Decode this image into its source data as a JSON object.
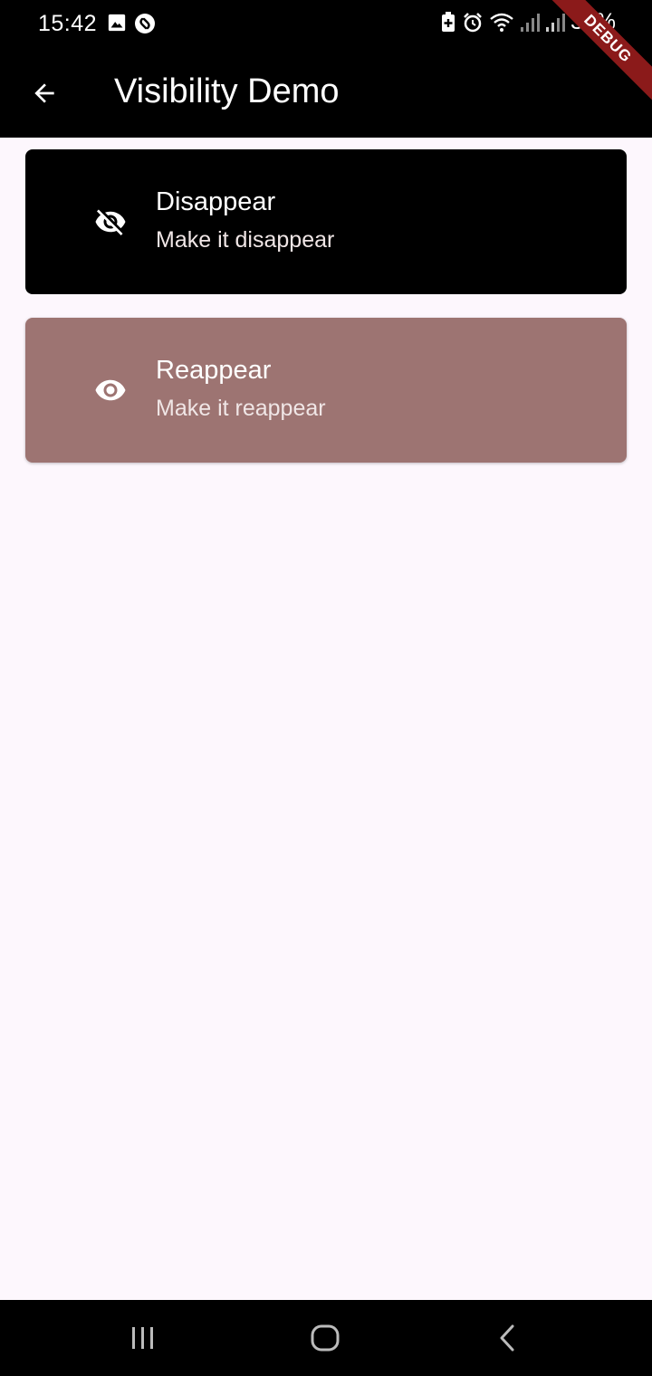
{
  "status_bar": {
    "time": "15:42",
    "battery": "39%",
    "left_icons": [
      "image-icon",
      "shazam-icon"
    ],
    "right_icons": [
      "battery-saver-icon",
      "alarm-icon",
      "wifi-icon",
      "signal-icon",
      "signal-icon"
    ]
  },
  "app_bar": {
    "title": "Visibility Demo",
    "back_icon": "arrow-back-icon"
  },
  "debug_banner": "DEBUG",
  "cards": [
    {
      "title": "Disappear",
      "subtitle": "Make it disappear",
      "icon": "visibility-off-icon",
      "color": "#000000"
    },
    {
      "title": "Reappear",
      "subtitle": "Make it reappear",
      "icon": "visibility-icon",
      "color": "#9d7472"
    }
  ],
  "nav_bar": {
    "buttons": [
      "recents-icon",
      "home-icon",
      "back-icon"
    ]
  }
}
